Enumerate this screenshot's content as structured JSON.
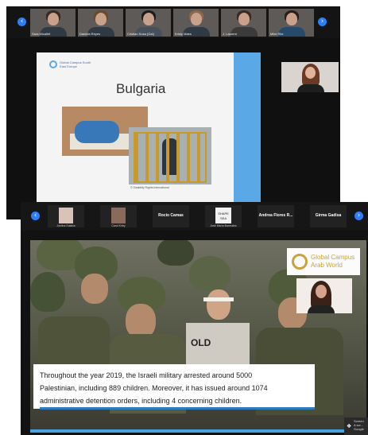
{
  "top_call": {
    "participants": [
      {
        "name": "Sara Micallef"
      },
      {
        "name": "Daniela Reyes"
      },
      {
        "name": "Cristian Sosa (Gal)"
      },
      {
        "name": "Kristy Maes"
      },
      {
        "name": "J. Laurent"
      },
      {
        "name": "Mike Ritz"
      }
    ],
    "nav": {
      "prev": "‹",
      "next": "›"
    },
    "slide": {
      "logo_text": "Global Campus South East Europe",
      "title": "Bulgaria",
      "photo_credit": "© Disability Rights International"
    }
  },
  "bottom_call": {
    "participants": [
      {
        "name": "Joelina Sulaiss"
      },
      {
        "name": "Carol Kirby"
      },
      {
        "name": "Rocio Camas",
        "video_off": true
      },
      {
        "name": "José María Barreales",
        "badge": "SHAPE SEA"
      },
      {
        "name": "Andrea Flores R...",
        "video_off": true
      },
      {
        "name": "Girma Gadisa",
        "video_off": true
      }
    ],
    "nav": {
      "prev": "‹",
      "next": "›"
    },
    "slide": {
      "brand_line1": "Global Campus",
      "brand_line2": "Arab World",
      "shirt_text": "OLD",
      "caption_lines": [
        "Throughout the year 2019, the Israeli military arrested around 5000",
        "Palestinian, including 889 children. Moreover, it has issued around 1074",
        "administrative detention orders, including 4 concerning children."
      ]
    },
    "share": {
      "label_line1": "Screen",
      "label_line2": "A scr...",
      "label_line3": "Google"
    }
  },
  "colors": {
    "accent_blue": "#2d7ff9",
    "brand_gold": "#c9a43a",
    "slide_blue": "#5aa9e6"
  }
}
